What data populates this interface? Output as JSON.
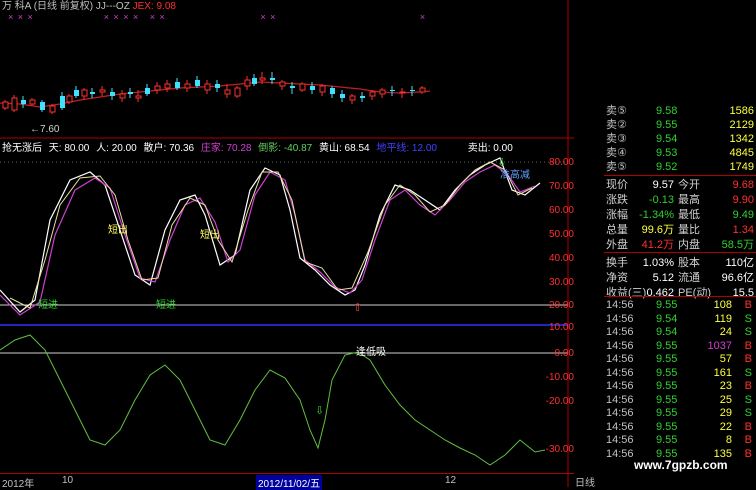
{
  "title_bar": {
    "stock": "万 科A",
    "mode": "(日线 前复权)",
    "code": "JJ---OZ",
    "jex": "JEX: 9.08"
  },
  "price_low_label": "←7.60",
  "indicator": {
    "name": "抢无涨后",
    "items": [
      {
        "label": "天: 80.00",
        "color": "#ffffff"
      },
      {
        "label": "人: 20.00",
        "color": "#ffffff"
      },
      {
        "label": "散户: 70.36",
        "color": "#ffffff"
      },
      {
        "label": "庄家: 70.28",
        "color": "#d040d0"
      },
      {
        "label": "倒影: -40.87",
        "color": "#60d060"
      },
      {
        "label": "黄山: 68.54",
        "color": "#ffffff"
      },
      {
        "label": "地平线: 12.00",
        "color": "#4040ff"
      },
      {
        "label": "卖出: 0.00",
        "color": "#ffffff"
      }
    ]
  },
  "annotations": [
    "短出",
    "短出",
    "短进",
    "短进",
    "准高减",
    "逢低吸"
  ],
  "axis_labels": [
    "80.00",
    "70.00",
    "60.00",
    "50.00",
    "40.00",
    "30.00",
    "20.00",
    "10.00",
    "0.00",
    "-10.00",
    "-20.00",
    "-30.00"
  ],
  "dates": {
    "d1": "2012年",
    "d2": "10",
    "d3": "2012/11/02/五",
    "d4": "12"
  },
  "day_label": "日线",
  "asks": [
    {
      "label": "卖⑤",
      "price": "9.58",
      "vol": "1586"
    },
    {
      "label": "卖②",
      "price": "9.55",
      "vol": "2129"
    },
    {
      "label": "卖③",
      "price": "9.54",
      "vol": "1342"
    },
    {
      "label": "卖④",
      "price": "9.53",
      "vol": "4845"
    },
    {
      "label": "卖⑤",
      "price": "9.52",
      "vol": "1749"
    }
  ],
  "stats": [
    {
      "l1": "现价",
      "v1": "9.57",
      "c1": "#ffffff",
      "l2": "今开",
      "v2": "9.68",
      "c2": "#ff3030"
    },
    {
      "l1": "涨跌",
      "v1": "-0.13",
      "c1": "#30d030",
      "l2": "最高",
      "v2": "9.90",
      "c2": "#ff3030"
    },
    {
      "l1": "涨幅",
      "v1": "-1.34%",
      "c1": "#30d030",
      "l2": "最低",
      "v2": "9.49",
      "c2": "#30d030"
    },
    {
      "l1": "总量",
      "v1": "99.6万",
      "c1": "#ffff40",
      "l2": "量比",
      "v2": "1.34",
      "c2": "#ff3030"
    },
    {
      "l1": "外盘",
      "v1": "41.2万",
      "c1": "#ff3030",
      "l2": "内盘",
      "v2": "58.5万",
      "c2": "#30d030"
    },
    {
      "l1": "换手",
      "v1": "1.03%",
      "c1": "#ffffff",
      "l2": "股本",
      "v2": "110亿",
      "c2": "#ffffff"
    },
    {
      "l1": "净资",
      "v1": "5.12",
      "c1": "#ffffff",
      "l2": "流通",
      "v2": "96.6亿",
      "c2": "#ffffff"
    },
    {
      "l1": "收益(三)",
      "v1": "0.462",
      "c1": "#ffffff",
      "l2": "PE(动)",
      "v2": "15.5",
      "c2": "#ffffff"
    }
  ],
  "trades": [
    {
      "time": "14:56",
      "price": "9.55",
      "vol": "108",
      "side": "B"
    },
    {
      "time": "14:56",
      "price": "9.54",
      "vol": "119",
      "side": "S"
    },
    {
      "time": "14:56",
      "price": "9.54",
      "vol": "24",
      "side": "S"
    },
    {
      "time": "14:56",
      "price": "9.55",
      "vol": "1037",
      "side": "B"
    },
    {
      "time": "14:56",
      "price": "9.55",
      "vol": "57",
      "side": "B"
    },
    {
      "time": "14:56",
      "price": "9.55",
      "vol": "161",
      "side": "S"
    },
    {
      "time": "14:56",
      "price": "9.55",
      "vol": "23",
      "side": "B"
    },
    {
      "time": "14:56",
      "price": "9.55",
      "vol": "25",
      "side": "S"
    },
    {
      "time": "14:56",
      "price": "9.55",
      "vol": "29",
      "side": "S"
    },
    {
      "time": "14:56",
      "price": "9.55",
      "vol": "22",
      "side": "B"
    },
    {
      "time": "14:56",
      "price": "9.55",
      "vol": "8",
      "side": "B"
    },
    {
      "time": "14:56",
      "price": "9.55",
      "vol": "135",
      "side": "B"
    }
  ],
  "watermark": "www.7gpzb.com"
}
